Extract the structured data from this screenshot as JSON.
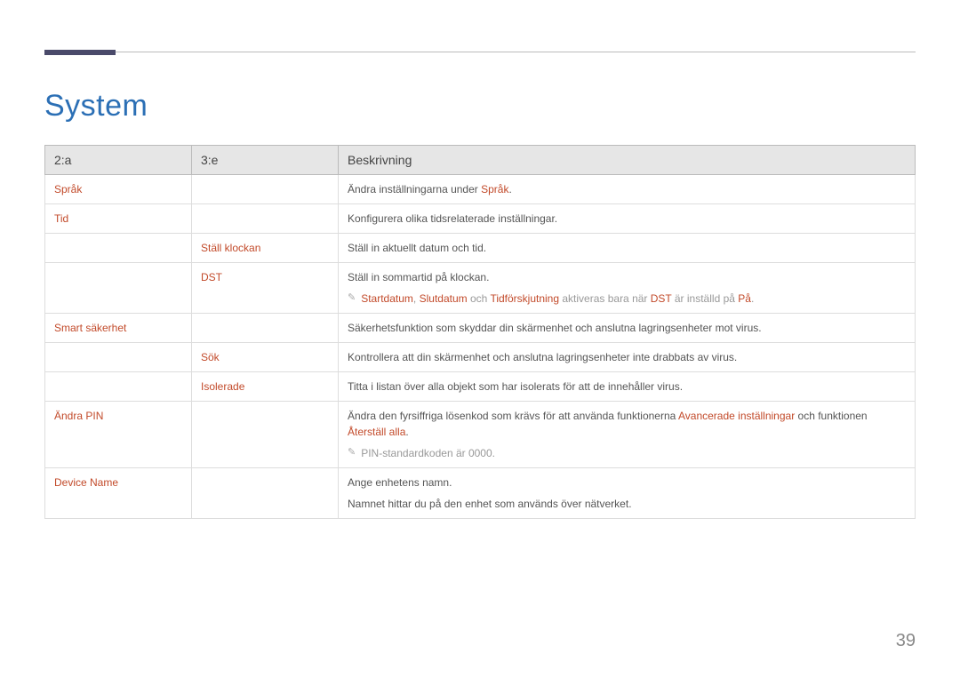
{
  "section_title": "System",
  "page_number": "39",
  "headers": {
    "col1": "2:a",
    "col2": "3:e",
    "col3": "Beskrivning"
  },
  "rows": {
    "sprak": {
      "c2a": "Språk",
      "desc_prefix": "Ändra inställningarna under ",
      "desc_accent": "Språk",
      "desc_suffix": "."
    },
    "tid": {
      "c2a": "Tid",
      "desc": "Konfigurera olika tidsrelaterade inställningar."
    },
    "stall_klockan": {
      "c3e": "Ställ klockan",
      "desc": "Ställ in aktuellt datum och tid."
    },
    "dst": {
      "c3e": "DST",
      "desc": "Ställ in sommartid på klockan.",
      "note_a1": "Startdatum",
      "note_sep1": ", ",
      "note_a2": "Slutdatum",
      "note_mid1": " och ",
      "note_a3": "Tidförskjutning",
      "note_mid2": " aktiveras bara när ",
      "note_a4": "DST",
      "note_mid3": " är inställd på ",
      "note_a5": "På",
      "note_end": "."
    },
    "smart": {
      "c2a": "Smart säkerhet",
      "desc": "Säkerhetsfunktion som skyddar din skärmenhet och anslutna lagringsenheter mot virus."
    },
    "sok": {
      "c3e": "Sök",
      "desc": "Kontrollera att din skärmenhet och anslutna lagringsenheter inte drabbats av virus."
    },
    "isolerade": {
      "c3e": "Isolerade",
      "desc": "Titta i listan över alla objekt som har isolerats för att de innehåller virus."
    },
    "andra_pin": {
      "c2a": "Ändra PIN",
      "desc_prefix": "Ändra den fyrsiffriga lösenkod som krävs för att använda funktionerna ",
      "desc_a1": "Avancerade inställningar",
      "desc_mid": " och funktionen ",
      "desc_a2": "Återställ alla",
      "desc_suffix": ".",
      "note": "PIN-standardkoden är 0000."
    },
    "device_name": {
      "c2a": "Device Name",
      "desc_l1": "Ange enhetens namn.",
      "desc_l2": "Namnet hittar du på den enhet som används över nätverket."
    }
  }
}
